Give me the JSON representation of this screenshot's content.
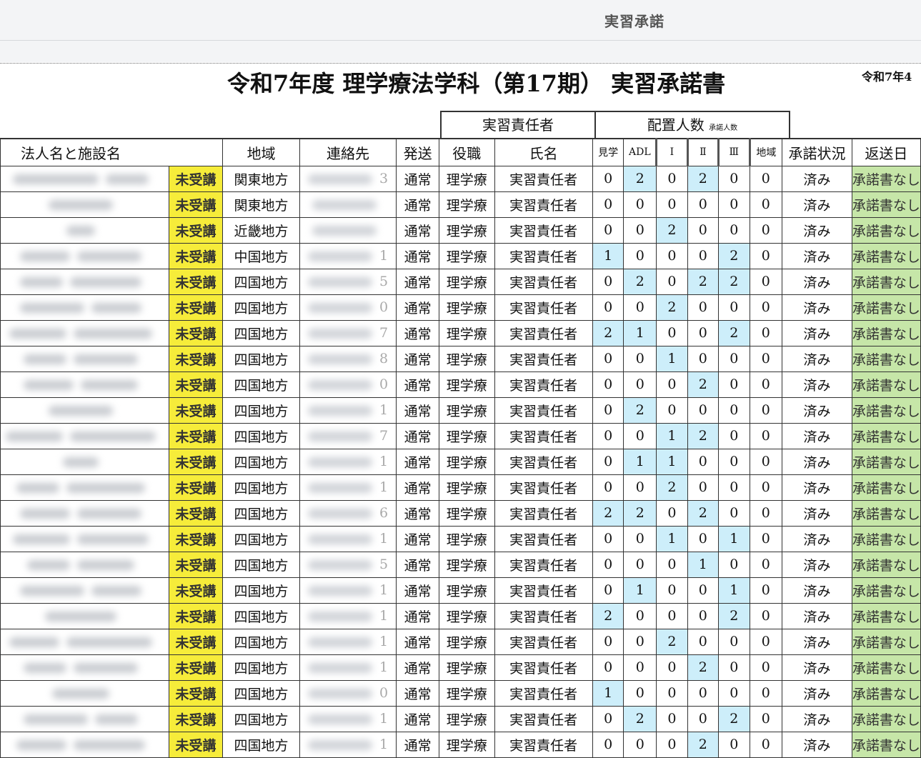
{
  "app": {
    "title": "実習承諾"
  },
  "document": {
    "title": "令和7年度 理学療法学科（第17期） 実習承諾書",
    "date": "令和7年4"
  },
  "groups": {
    "responsible": "実習責任者",
    "placement": "配置人数",
    "placement_sub": "承諾人数"
  },
  "columns": {
    "name": "法人名と施設名",
    "region": "地域",
    "contact": "連絡先",
    "send": "発送",
    "role": "役職",
    "person": "氏名",
    "kengaku": "見学",
    "adl": "ADL",
    "r1": "Ⅰ",
    "r2": "Ⅱ",
    "r3": "Ⅲ",
    "chiiki": "地域",
    "status": "承諾状況",
    "returned": "返送日"
  },
  "rows": [
    {
      "badge": "未受講",
      "region": "関東地方",
      "phone_tail": "3",
      "send": "通常",
      "role": "理学療",
      "person": "実習責任者",
      "kengaku": "0",
      "adl": "2",
      "r1": "0",
      "r2": "2",
      "r3": "0",
      "chiiki": "0",
      "status": "済み",
      "returned": "承諾書なし"
    },
    {
      "badge": "未受講",
      "region": "関東地方",
      "phone_tail": "",
      "send": "通常",
      "role": "理学療",
      "person": "実習責任者",
      "kengaku": "0",
      "adl": "0",
      "r1": "0",
      "r2": "0",
      "r3": "0",
      "chiiki": "0",
      "status": "済み",
      "returned": "承諾書なし"
    },
    {
      "badge": "未受講",
      "region": "近畿地方",
      "phone_tail": "",
      "send": "通常",
      "role": "理学療",
      "person": "実習責任者",
      "kengaku": "0",
      "adl": "0",
      "r1": "2",
      "r2": "0",
      "r3": "0",
      "chiiki": "0",
      "status": "済み",
      "returned": "承諾書なし"
    },
    {
      "badge": "未受講",
      "region": "中国地方",
      "phone_tail": "1",
      "send": "通常",
      "role": "理学療",
      "person": "実習責任者",
      "kengaku": "1",
      "adl": "0",
      "r1": "0",
      "r2": "0",
      "r3": "2",
      "chiiki": "0",
      "status": "済み",
      "returned": "承諾書なし"
    },
    {
      "badge": "未受講",
      "region": "四国地方",
      "phone_tail": "5",
      "send": "通常",
      "role": "理学療",
      "person": "実習責任者",
      "kengaku": "0",
      "adl": "2",
      "r1": "0",
      "r2": "2",
      "r3": "2",
      "chiiki": "0",
      "status": "済み",
      "returned": "承諾書なし"
    },
    {
      "badge": "未受講",
      "region": "四国地方",
      "phone_tail": "0",
      "send": "通常",
      "role": "理学療",
      "person": "実習責任者",
      "kengaku": "0",
      "adl": "0",
      "r1": "2",
      "r2": "0",
      "r3": "0",
      "chiiki": "0",
      "status": "済み",
      "returned": "承諾書なし"
    },
    {
      "badge": "未受講",
      "region": "四国地方",
      "phone_tail": "7",
      "send": "通常",
      "role": "理学療",
      "person": "実習責任者",
      "kengaku": "2",
      "adl": "1",
      "r1": "0",
      "r2": "0",
      "r3": "2",
      "chiiki": "0",
      "status": "済み",
      "returned": "承諾書なし"
    },
    {
      "badge": "未受講",
      "region": "四国地方",
      "phone_tail": "8",
      "send": "通常",
      "role": "理学療",
      "person": "実習責任者",
      "kengaku": "0",
      "adl": "0",
      "r1": "1",
      "r2": "0",
      "r3": "0",
      "chiiki": "0",
      "status": "済み",
      "returned": "承諾書なし"
    },
    {
      "badge": "未受講",
      "region": "四国地方",
      "phone_tail": "0",
      "send": "通常",
      "role": "理学療",
      "person": "実習責任者",
      "kengaku": "0",
      "adl": "0",
      "r1": "0",
      "r2": "2",
      "r3": "0",
      "chiiki": "0",
      "status": "済み",
      "returned": "承諾書なし"
    },
    {
      "badge": "未受講",
      "region": "四国地方",
      "phone_tail": "1",
      "send": "通常",
      "role": "理学療",
      "person": "実習責任者",
      "kengaku": "0",
      "adl": "2",
      "r1": "0",
      "r2": "0",
      "r3": "0",
      "chiiki": "0",
      "status": "済み",
      "returned": "承諾書なし"
    },
    {
      "badge": "未受講",
      "region": "四国地方",
      "phone_tail": "7",
      "send": "通常",
      "role": "理学療",
      "person": "実習責任者",
      "kengaku": "0",
      "adl": "0",
      "r1": "1",
      "r2": "2",
      "r3": "0",
      "chiiki": "0",
      "status": "済み",
      "returned": "承諾書なし"
    },
    {
      "badge": "未受講",
      "region": "四国地方",
      "phone_tail": "1",
      "send": "通常",
      "role": "理学療",
      "person": "実習責任者",
      "kengaku": "0",
      "adl": "1",
      "r1": "1",
      "r2": "0",
      "r3": "0",
      "chiiki": "0",
      "status": "済み",
      "returned": "承諾書なし"
    },
    {
      "badge": "未受講",
      "region": "四国地方",
      "phone_tail": "1",
      "send": "通常",
      "role": "理学療",
      "person": "実習責任者",
      "kengaku": "0",
      "adl": "0",
      "r1": "2",
      "r2": "0",
      "r3": "0",
      "chiiki": "0",
      "status": "済み",
      "returned": "承諾書なし"
    },
    {
      "badge": "未受講",
      "region": "四国地方",
      "phone_tail": "6",
      "send": "通常",
      "role": "理学療",
      "person": "実習責任者",
      "kengaku": "2",
      "adl": "2",
      "r1": "0",
      "r2": "2",
      "r3": "0",
      "chiiki": "0",
      "status": "済み",
      "returned": "承諾書なし"
    },
    {
      "badge": "未受講",
      "region": "四国地方",
      "phone_tail": "1",
      "send": "通常",
      "role": "理学療",
      "person": "実習責任者",
      "kengaku": "0",
      "adl": "0",
      "r1": "1",
      "r2": "0",
      "r3": "1",
      "chiiki": "0",
      "status": "済み",
      "returned": "承諾書なし"
    },
    {
      "badge": "未受講",
      "region": "四国地方",
      "phone_tail": "5",
      "send": "通常",
      "role": "理学療",
      "person": "実習責任者",
      "kengaku": "0",
      "adl": "0",
      "r1": "0",
      "r2": "1",
      "r3": "0",
      "chiiki": "0",
      "status": "済み",
      "returned": "承諾書なし"
    },
    {
      "badge": "未受講",
      "region": "四国地方",
      "phone_tail": "1",
      "send": "通常",
      "role": "理学療",
      "person": "実習責任者",
      "kengaku": "0",
      "adl": "1",
      "r1": "0",
      "r2": "0",
      "r3": "1",
      "chiiki": "0",
      "status": "済み",
      "returned": "承諾書なし"
    },
    {
      "badge": "未受講",
      "region": "四国地方",
      "phone_tail": "1",
      "send": "通常",
      "role": "理学療",
      "person": "実習責任者",
      "kengaku": "2",
      "adl": "0",
      "r1": "0",
      "r2": "0",
      "r3": "2",
      "chiiki": "0",
      "status": "済み",
      "returned": "承諾書なし"
    },
    {
      "badge": "未受講",
      "region": "四国地方",
      "phone_tail": "1",
      "send": "通常",
      "role": "理学療",
      "person": "実習責任者",
      "kengaku": "0",
      "adl": "0",
      "r1": "2",
      "r2": "0",
      "r3": "0",
      "chiiki": "0",
      "status": "済み",
      "returned": "承諾書なし"
    },
    {
      "badge": "未受講",
      "region": "四国地方",
      "phone_tail": "1",
      "send": "通常",
      "role": "理学療",
      "person": "実習責任者",
      "kengaku": "0",
      "adl": "0",
      "r1": "0",
      "r2": "2",
      "r3": "0",
      "chiiki": "0",
      "status": "済み",
      "returned": "承諾書なし"
    },
    {
      "badge": "未受講",
      "region": "四国地方",
      "phone_tail": "0",
      "send": "通常",
      "role": "理学療",
      "person": "実習責任者",
      "kengaku": "1",
      "adl": "0",
      "r1": "0",
      "r2": "0",
      "r3": "0",
      "chiiki": "0",
      "status": "済み",
      "returned": "承諾書なし"
    },
    {
      "badge": "未受講",
      "region": "四国地方",
      "phone_tail": "1",
      "send": "通常",
      "role": "理学療",
      "person": "実習責任者",
      "kengaku": "0",
      "adl": "2",
      "r1": "0",
      "r2": "0",
      "r3": "2",
      "chiiki": "0",
      "status": "済み",
      "returned": "承諾書なし"
    },
    {
      "badge": "未受講",
      "region": "四国地方",
      "phone_tail": "1",
      "send": "通常",
      "role": "理学療",
      "person": "実習責任者",
      "kengaku": "0",
      "adl": "0",
      "r1": "0",
      "r2": "2",
      "r3": "0",
      "chiiki": "0",
      "status": "済み",
      "returned": "承諾書なし"
    }
  ]
}
